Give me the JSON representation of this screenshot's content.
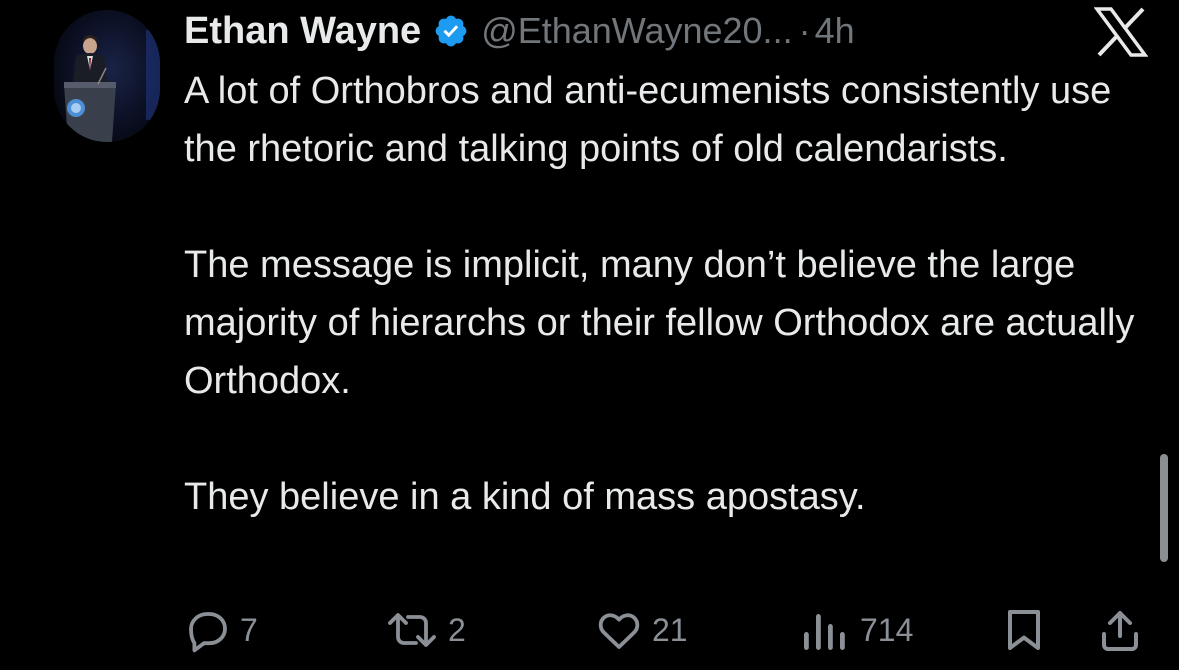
{
  "author": {
    "display_name": "Ethan Wayne",
    "handle": "@EthanWayne20...",
    "separator": "·",
    "time": "4h",
    "verified": true
  },
  "brand": {
    "logo_icon": "x-logo-icon"
  },
  "tweet": {
    "paragraphs": [
      "A lot of Orthobros and anti-ecumenists consistently use the rhetoric and talking points of old calendarists.",
      "The message is implicit, many don’t believe the large majority of hierarchs or their fellow Orthodox are actually Orthodox.",
      "They believe in a kind of mass apostasy."
    ]
  },
  "actions": {
    "reply": {
      "icon": "reply-icon",
      "count": "7"
    },
    "retweet": {
      "icon": "retweet-icon",
      "count": "2"
    },
    "like": {
      "icon": "heart-icon",
      "count": "21"
    },
    "views": {
      "icon": "views-icon",
      "count": "714"
    },
    "bookmark": {
      "icon": "bookmark-icon"
    },
    "share": {
      "icon": "share-icon"
    }
  },
  "colors": {
    "background": "#000000",
    "text": "#e7e9ea",
    "secondary": "#71767b",
    "verified_blue": "#1d9bf0"
  }
}
